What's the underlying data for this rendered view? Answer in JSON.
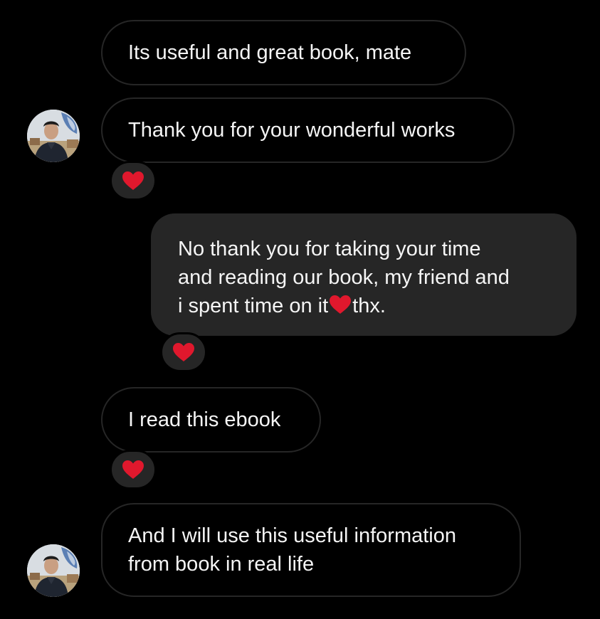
{
  "messages": [
    {
      "side": "received",
      "text": "Its useful and great book, mate"
    },
    {
      "side": "received",
      "text": "Thank you for your wonderful works",
      "reaction": "heart"
    },
    {
      "side": "sent",
      "lines": [
        "No thank you for taking your time",
        "and reading our book, my friend and",
        "i spent time on it"
      ],
      "line_suffix": "thx.",
      "reaction": "heart"
    },
    {
      "side": "received",
      "text": "I read this ebook",
      "reaction": "heart"
    },
    {
      "side": "received",
      "lines": [
        "And I will use this useful information",
        "from book in real life"
      ]
    }
  ],
  "colors": {
    "background": "#000000",
    "sent_bubble": "#262626",
    "received_border": "#262626",
    "heart": "#e0182d"
  },
  "icons": {
    "reaction": "heart-icon",
    "inline": "heart-icon",
    "avatar": "user-avatar"
  }
}
